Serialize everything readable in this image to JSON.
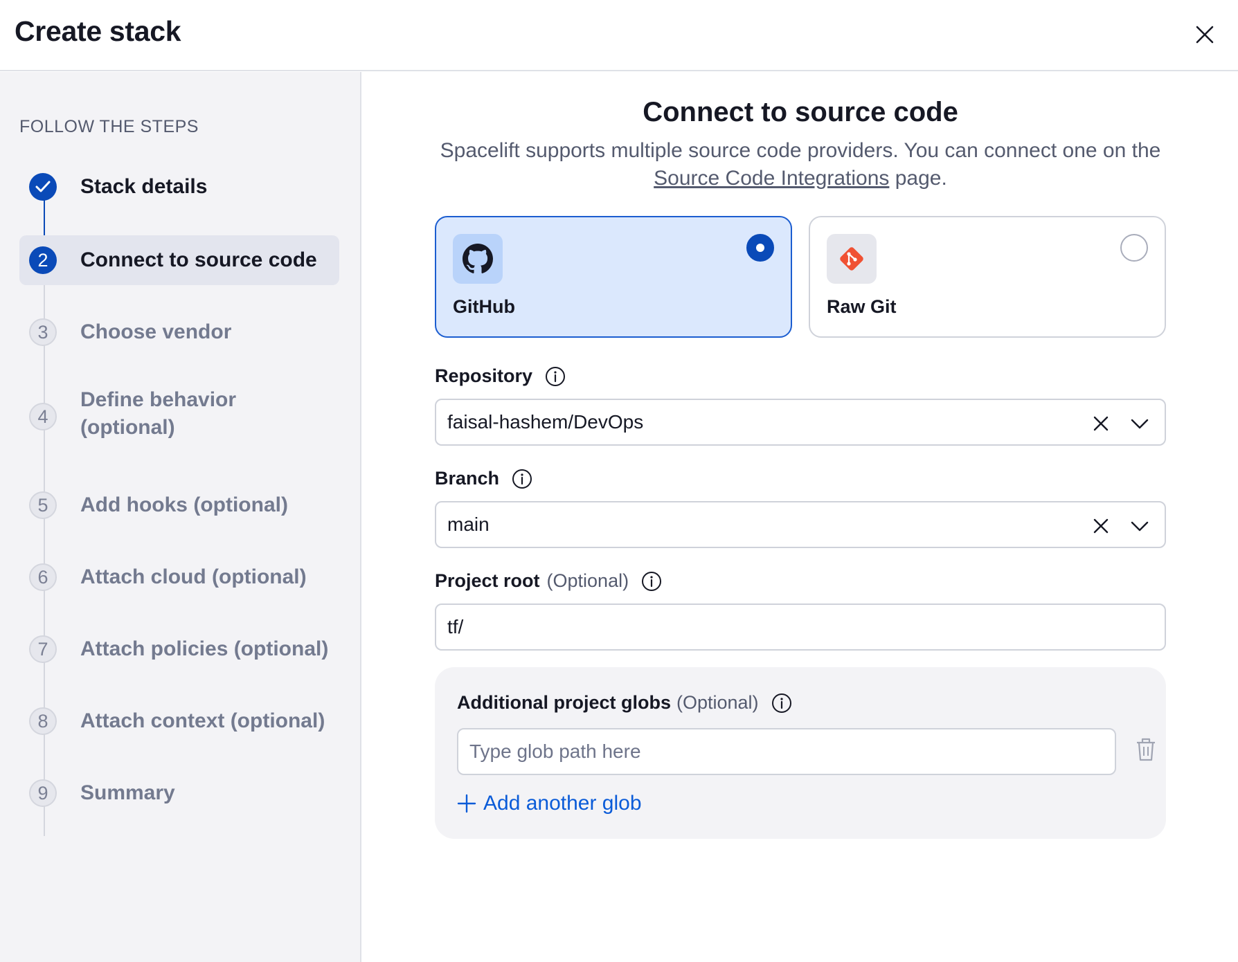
{
  "header": {
    "title": "Create stack"
  },
  "sidebar": {
    "heading": "FOLLOW THE STEPS",
    "steps": [
      {
        "num": "1",
        "label": "Stack details",
        "state": "done"
      },
      {
        "num": "2",
        "label": "Connect to source code",
        "state": "active"
      },
      {
        "num": "3",
        "label": "Choose vendor",
        "state": "pending"
      },
      {
        "num": "4",
        "label": "Define behavior (optional)",
        "state": "pending"
      },
      {
        "num": "5",
        "label": "Add hooks (optional)",
        "state": "pending"
      },
      {
        "num": "6",
        "label": "Attach cloud (optional)",
        "state": "pending"
      },
      {
        "num": "7",
        "label": "Attach policies (optional)",
        "state": "pending"
      },
      {
        "num": "8",
        "label": "Attach context (optional)",
        "state": "pending"
      },
      {
        "num": "9",
        "label": "Summary",
        "state": "pending"
      }
    ]
  },
  "main": {
    "title": "Connect to source code",
    "desc_before": "Spacelift supports multiple source code providers. You can connect one on the ",
    "desc_link": "Source Code Integrations",
    "desc_after": " page.",
    "providers": [
      {
        "label": "GitHub",
        "icon": "github-icon",
        "selected": true
      },
      {
        "label": "Raw Git",
        "icon": "git-icon",
        "selected": false
      }
    ],
    "repository": {
      "label": "Repository",
      "value": "faisal-hashem/DevOps"
    },
    "branch": {
      "label": "Branch",
      "value": "main"
    },
    "project_root": {
      "label": "Project root",
      "optional": "(Optional)",
      "value": "tf/"
    },
    "globs": {
      "label": "Additional project globs",
      "optional": "(Optional)",
      "placeholder": "Type glob path here",
      "add_label": "Add another glob"
    }
  },
  "colors": {
    "accent": "#0a4ab8",
    "link": "#0a5bd8",
    "selected_bg": "#dbe8fd",
    "git_orange": "#f05133"
  }
}
